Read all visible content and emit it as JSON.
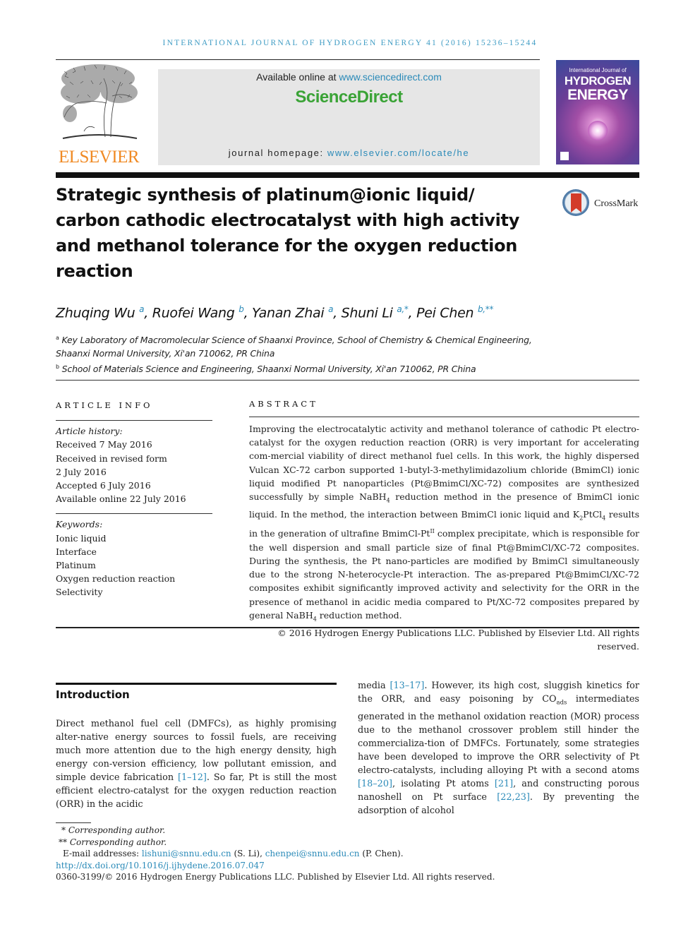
{
  "running_head": "INTERNATIONAL JOURNAL OF HYDROGEN ENERGY 41 (2016) 15236–15244",
  "masthead": {
    "publisher_logo_text": "ELSEVIER",
    "available_online_prefix": "Available online at ",
    "available_online_link": "www.sciencedirect.com",
    "brand": "ScienceDirect",
    "homepage_prefix": "journal homepage: ",
    "homepage_link": "www.elsevier.com/locate/he",
    "cover": {
      "line1": "International Journal of",
      "line2": "HYDROGEN",
      "line3": "ENERGY"
    },
    "crossmark_label": "CrossMark",
    "colors": {
      "elsevier_orange": "#f08a24",
      "sciencedirect_green": "#3aa336",
      "link_blue": "#2a8ab8"
    }
  },
  "article": {
    "title": "Strategic synthesis of platinum@ionic liquid/ carbon cathodic electrocatalyst with high activity and methanol tolerance for the oxygen reduction reaction",
    "authors": [
      {
        "name": "Zhuqing Wu",
        "sup": "a"
      },
      {
        "name": "Ruofei Wang",
        "sup": "b"
      },
      {
        "name": "Yanan Zhai",
        "sup": "a"
      },
      {
        "name": "Shuni Li",
        "sup": "a,*"
      },
      {
        "name": "Pei Chen",
        "sup": "b,**"
      }
    ],
    "affiliations": [
      {
        "sup": "a",
        "text": "Key Laboratory of Macromolecular Science of Shaanxi Province, School of Chemistry & Chemical Engineering, Shaanxi Normal University, Xi'an 710062, PR China"
      },
      {
        "sup": "b",
        "text": "School of Materials Science and Engineering, Shaanxi Normal University, Xi'an 710062, PR China"
      }
    ]
  },
  "article_info": {
    "heading": "ARTICLE INFO",
    "history_label": "Article history:",
    "history": [
      "Received 7 May 2016",
      "Received in revised form",
      "2 July 2016",
      "Accepted 6 July 2016",
      "Available online 22 July 2016"
    ],
    "keywords_label": "Keywords:",
    "keywords": [
      "Ionic liquid",
      "Interface",
      "Platinum",
      "Oxygen reduction reaction",
      "Selectivity"
    ]
  },
  "abstract": {
    "heading": "ABSTRACT",
    "p1": "Improving the electrocatalytic activity and methanol tolerance of cathodic Pt electro-catalyst for the oxygen reduction reaction (ORR) is very important for accelerating com-mercial viability of direct methanol fuel cells. In this work, the highly dispersed Vulcan XC-72 carbon supported 1-butyl-3-methylimidazolium chloride (BmimCl) ionic liquid modified Pt nanoparticles (Pt@BmimCl/XC-72) composites are synthesized successfully by simple NaBH",
    "p1_sub1": "4",
    "p2": " reduction method in the presence of BmimCl ionic liquid. In the method, the interaction between BmimCl ionic liquid and K",
    "p2_sub1": "2",
    "p3": "PtCl",
    "p3_sub1": "4",
    "p4": " results in the generation of ultrafine BmimCl-Pt",
    "p4_sup1": "II",
    "p5": " complex precipitate, which is responsible for the well dispersion and small particle size of final Pt@BmimCl/XC-72 composites. During the synthesis, the Pt nano-particles are modified by BmimCl simultaneously due to the strong N-heterocycle-Pt interaction. The as-prepared Pt@BmimCl/XC-72 composites exhibit significantly improved activity and selectivity for the ORR in the presence of methanol in acidic media compared to Pt/XC-72 composites prepared by general NaBH",
    "p5_sub1": "4",
    "p6": " reduction method.",
    "copyright": "© 2016 Hydrogen Energy Publications LLC. Published by Elsevier Ltd. All rights reserved."
  },
  "introduction": {
    "heading": "Introduction",
    "left": {
      "t1": "Direct methanol fuel cell (DMFCs), as highly promising alter-native energy sources to fossil fuels, are receiving much more attention due to the high energy density, high energy con-version efficiency, low pollutant emission, and simple device fabrication ",
      "ref1": "[1–12]",
      "t2": ". So far, Pt is still the most efficient electro-catalyst for the oxygen reduction reaction (ORR) in the acidic"
    },
    "right": {
      "t1": "media ",
      "ref1": "[13–17]",
      "t2": ". However, its high cost, sluggish kinetics for the ORR, and easy poisoning by CO",
      "sub1": "ads",
      "t3": " intermediates generated in the methanol oxidation reaction (MOR) process due to the methanol crossover problem still hinder the commercializa-tion of DMFCs. Fortunately, some strategies have been developed to improve the ORR selectivity of Pt electro-catalysts, including alloying Pt with a second atoms ",
      "ref2": "[18–20]",
      "t4": ", isolating Pt atoms ",
      "ref3": "[21]",
      "t5": ", and constructing porous nanoshell on Pt surface ",
      "ref4": "[22,23]",
      "t6": ". By preventing the adsorption of alcohol"
    }
  },
  "footnotes": {
    "corr1": "* Corresponding author.",
    "corr2": "** Corresponding author.",
    "email_label": "E-mail addresses: ",
    "email1": "lishuni@snnu.edu.cn",
    "email1_owner": " (S. Li), ",
    "email2": "chenpei@snnu.edu.cn",
    "email2_owner": " (P. Chen).",
    "doi": "http://dx.doi.org/10.1016/j.ijhydene.2016.07.047",
    "issn_copyright": "0360-3199/© 2016 Hydrogen Energy Publications LLC. Published by Elsevier Ltd. All rights reserved."
  }
}
